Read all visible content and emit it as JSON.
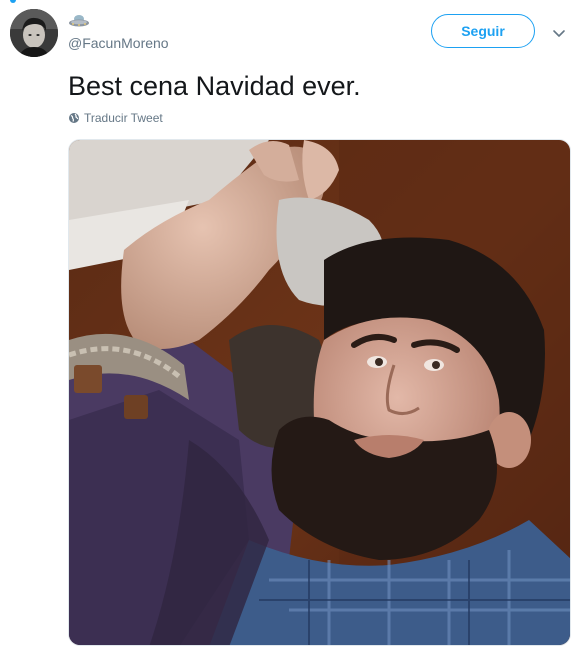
{
  "tweet": {
    "author_handle": "@FacunMoreno",
    "author_emoji_icon": "ufo-icon",
    "follow_label": "Seguir",
    "text": "Best cena Navidad ever.",
    "translate_label": "Traducir Tweet",
    "translate_icon": "globe-icon",
    "more_icon": "chevron-down-icon"
  },
  "colors": {
    "accent": "#1da1f2",
    "text": "#14171a",
    "secondary_text": "#657786",
    "border": "#e1e8ed"
  }
}
